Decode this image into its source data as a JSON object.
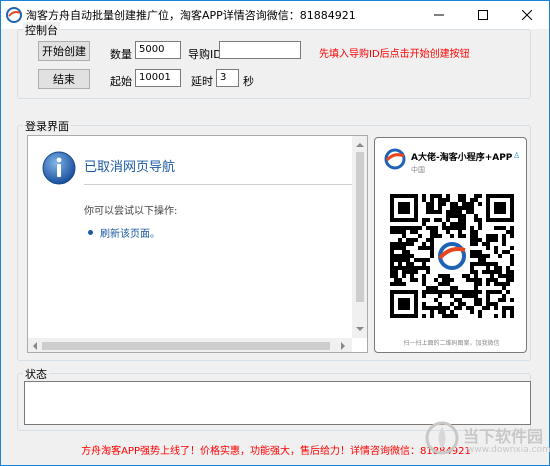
{
  "window": {
    "title": "淘客方舟自动批量创建推广位，淘客APP详情咨询微信：81884921"
  },
  "control_panel": {
    "label": "控制台",
    "start_button": "开始创建",
    "end_button": "结束",
    "quantity_label": "数量",
    "quantity_value": "5000",
    "guide_id_label": "导购ID",
    "guide_id_value": "",
    "hint": "先填入导购ID后点击开始创建按钮",
    "start_label": "起始",
    "start_value": "10001",
    "delay_label": "延时",
    "delay_value": "3",
    "seconds_label": "秒"
  },
  "login_panel": {
    "label": "登录界面",
    "browser": {
      "heading": "已取消网页导航",
      "subtext": "你可以尝试以下操作:",
      "action_link": "刷新该页面。"
    },
    "qr_card": {
      "name": "A大佬-淘客小程序+APP",
      "region": "中国",
      "caption": "扫一扫上面的二维码图案，加我微信"
    }
  },
  "status_panel": {
    "label": "状态",
    "value": ""
  },
  "footer": {
    "text": "方舟淘客APP强势上线了！价格实惠，功能强大，售后给力！详情咨询微信：81884921"
  },
  "watermark": {
    "cn": "当下软件园",
    "en": "www.downxia.com"
  }
}
